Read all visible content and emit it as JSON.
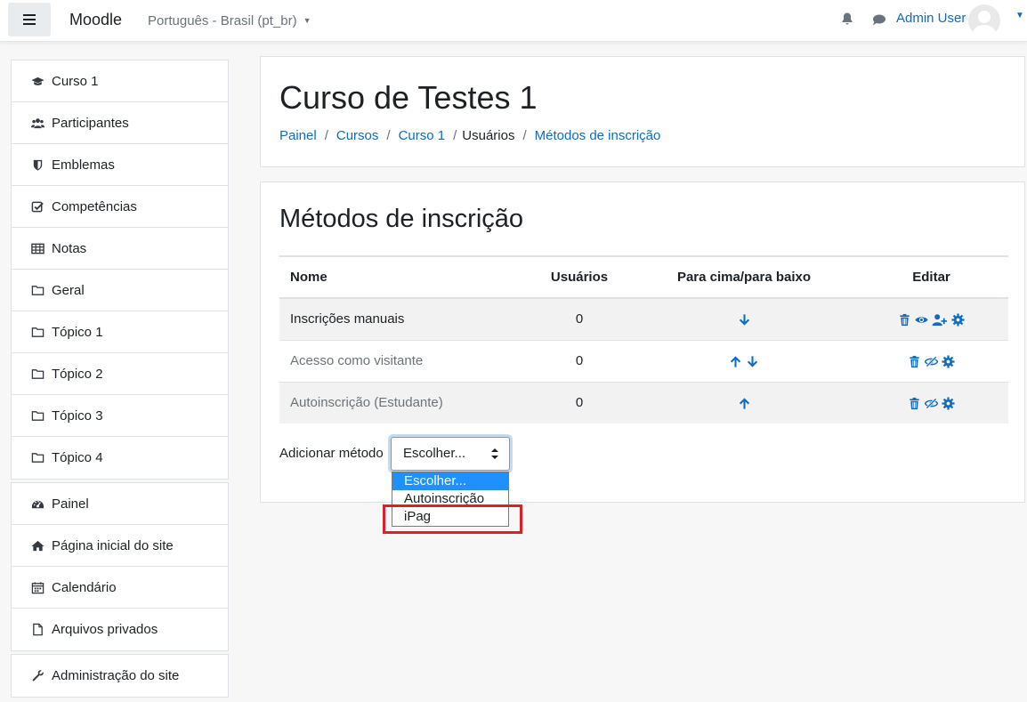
{
  "navbar": {
    "brand": "Moodle",
    "language": "Português - Brasil (pt_br)",
    "user_name": "Admin User",
    "icons": [
      "menu-icon",
      "bell-icon",
      "message-icon",
      "user-avatar",
      "caret-down-icon"
    ]
  },
  "sidebar": {
    "course_items": [
      {
        "label": "Curso 1",
        "icon": "graduation-cap-icon"
      },
      {
        "label": "Participantes",
        "icon": "users-icon"
      },
      {
        "label": "Emblemas",
        "icon": "shield-icon"
      },
      {
        "label": "Competências",
        "icon": "check-square-icon"
      },
      {
        "label": "Notas",
        "icon": "table-icon"
      },
      {
        "label": "Geral",
        "icon": "folder-icon"
      },
      {
        "label": "Tópico 1",
        "icon": "folder-icon"
      },
      {
        "label": "Tópico 2",
        "icon": "folder-icon"
      },
      {
        "label": "Tópico 3",
        "icon": "folder-icon"
      },
      {
        "label": "Tópico 4",
        "icon": "folder-icon"
      }
    ],
    "site_items": [
      {
        "label": "Painel",
        "icon": "dashboard-icon"
      },
      {
        "label": "Página inicial do site",
        "icon": "home-icon"
      },
      {
        "label": "Calendário",
        "icon": "calendar-icon"
      },
      {
        "label": "Arquivos privados",
        "icon": "file-icon"
      }
    ],
    "admin_items": [
      {
        "label": "Administração do site",
        "icon": "wrench-icon"
      }
    ]
  },
  "header": {
    "title": "Curso de Testes 1",
    "breadcrumb": [
      "Painel",
      "Cursos",
      "Curso 1",
      "Usuários",
      "Métodos de inscrição"
    ]
  },
  "enrolment": {
    "title": "Métodos de inscrição",
    "columns": [
      "Nome",
      "Usuários",
      "Para cima/para baixo",
      "Editar"
    ],
    "rows": [
      {
        "name": "Inscrições manuais",
        "users": "0",
        "move": [
          "down"
        ],
        "edit": [
          "delete",
          "hide",
          "enrol-users",
          "settings"
        ],
        "disabled": false
      },
      {
        "name": "Acesso como visitante",
        "users": "0",
        "move": [
          "up",
          "down"
        ],
        "edit": [
          "delete",
          "show",
          "settings"
        ],
        "disabled": true
      },
      {
        "name": "Autoinscrição (Estudante)",
        "users": "0",
        "move": [
          "up"
        ],
        "edit": [
          "delete",
          "show",
          "settings"
        ],
        "disabled": true
      }
    ],
    "add_method_label": "Adicionar método",
    "select_value": "Escolher...",
    "options": [
      "Escolher...",
      "Autoinscrição",
      "iPag"
    ],
    "highlighted_option": "iPag"
  },
  "colors": {
    "link": "#0f6cbf",
    "highlight": "#d9202e",
    "selected_option": "#1e90ff"
  }
}
